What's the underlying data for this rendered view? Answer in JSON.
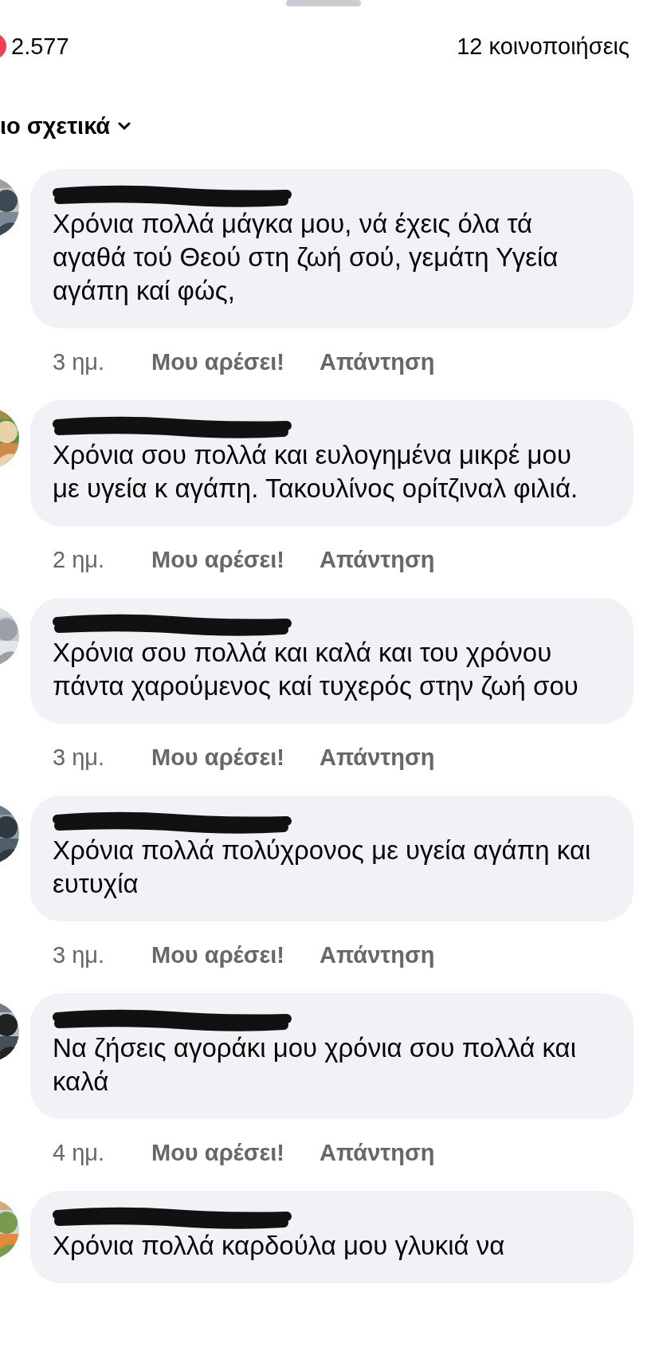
{
  "header": {
    "reactions_count": "2.577",
    "shares": "12 κοινοποιήσεις"
  },
  "filter": {
    "label": "ιο σχετικά"
  },
  "comments": [
    {
      "author_redacted": true,
      "text": "Χρόνια πολλά μάγκα μου, νά έχεις όλα τά αγαθά τού Θεού στη ζωή σού, γεμάτη Υγεία αγάπη καί φώς,",
      "time": "3 ημ.",
      "like": "Μου αρέσει!",
      "reply": "Απάντηση"
    },
    {
      "author_redacted": true,
      "text": "Χρόνια σου πολλά και ευλογημένα μικρέ μου με υγεία κ αγάπη. Τακουλίνος ορίτζιναλ φιλιά.",
      "time": "2 ημ.",
      "like": "Μου αρέσει!",
      "reply": "Απάντηση"
    },
    {
      "author_redacted": true,
      "text": "Χρόνια σου πολλά και καλά και του χρόνου πάντα χαρούμενος καί τυχερός στην ζωή σου",
      "time": "3 ημ.",
      "like": "Μου αρέσει!",
      "reply": "Απάντηση"
    },
    {
      "author_redacted": true,
      "text": "Χρόνια πολλά πολύχρονος  με  υγεία αγάπη και ευτυχία",
      "time": "3 ημ.",
      "like": "Μου αρέσει!",
      "reply": "Απάντηση"
    },
    {
      "author_redacted": true,
      "text": "Να ζήσεις αγοράκι μου χρόνια σου πολλά και καλά",
      "time": "4 ημ.",
      "like": "Μου αρέσει!",
      "reply": "Απάντηση"
    },
    {
      "author_redacted": true,
      "text": "Χρόνια πολλά καρδούλα μου γλυκιά να"
    }
  ]
}
